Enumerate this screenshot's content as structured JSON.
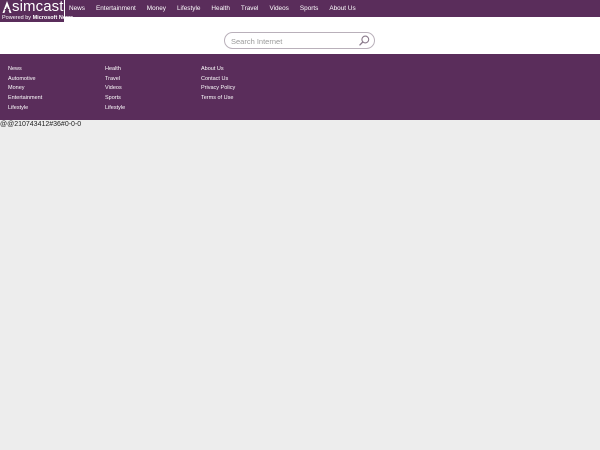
{
  "brand": {
    "name": "simcast",
    "powered_prefix": "Powered by ",
    "powered_brand": "Microsoft News"
  },
  "nav": {
    "items": [
      "News",
      "Entertainment",
      "Money",
      "Lifestyle",
      "Health",
      "Travel",
      "Videos",
      "Sports",
      "About Us"
    ]
  },
  "search": {
    "placeholder": "Search Internet",
    "value": ""
  },
  "footer": {
    "col1": [
      "News",
      "Automotive",
      "Money",
      "Entertainment",
      "Lifestyle"
    ],
    "col2": [
      "Health",
      "Travel",
      "Videos",
      "Sports",
      "Lifestyle"
    ],
    "col3": [
      "About Us",
      "Contact Us",
      "Privacy Policy",
      "Terms of Use"
    ]
  },
  "debug_text": "@@210743412#36#0-0-0",
  "colors": {
    "brand_purple": "#5a2d5b",
    "page_bg": "#ededed",
    "content_bg": "#ffffff"
  }
}
